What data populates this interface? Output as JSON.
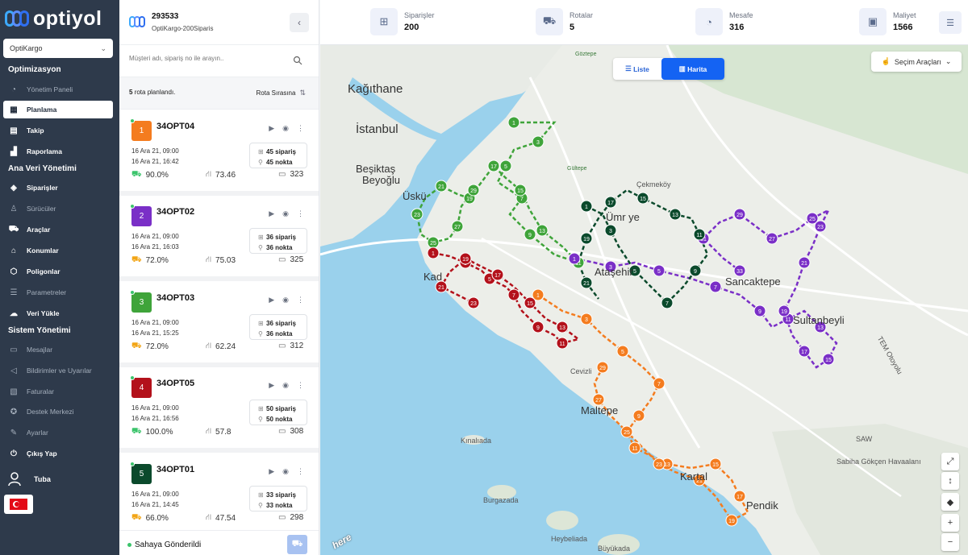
{
  "app": {
    "brand": "optiyol"
  },
  "org_select": {
    "value": "OptiKargo"
  },
  "nav": {
    "sections": [
      "Optimizasyon",
      "Ana Veri Yönetimi",
      "Sistem Yönetimi"
    ],
    "items": [
      {
        "label": "Yönetim Paneli",
        "icon": "dashboard-icon"
      },
      {
        "label": "Planlama",
        "icon": "calendar-icon"
      },
      {
        "label": "Takip",
        "icon": "clipboard-icon"
      },
      {
        "label": "Raporlama",
        "icon": "chart-icon"
      },
      {
        "label": "Siparişler",
        "icon": "box-icon"
      },
      {
        "label": "Sürücüler",
        "icon": "person-icon"
      },
      {
        "label": "Araçlar",
        "icon": "truck-icon"
      },
      {
        "label": "Konumlar",
        "icon": "location-icon"
      },
      {
        "label": "Poligonlar",
        "icon": "polygon-icon"
      },
      {
        "label": "Parametreler",
        "icon": "sliders-icon"
      },
      {
        "label": "Veri Yükle",
        "icon": "cloud-upload-icon"
      },
      {
        "label": "Mesajlar",
        "icon": "chat-icon"
      },
      {
        "label": "Bildirimler ve Uyarılar",
        "icon": "megaphone-icon"
      },
      {
        "label": "Faturalar",
        "icon": "invoice-icon"
      },
      {
        "label": "Destek Merkezi",
        "icon": "lightbulb-icon"
      },
      {
        "label": "Ayarlar",
        "icon": "wrench-icon"
      },
      {
        "label": "Çıkış Yap",
        "icon": "logout-icon"
      }
    ],
    "user": "Tuba"
  },
  "panel": {
    "id": "293533",
    "subtitle": "OptiKargo-200Siparis",
    "search_placeholder": "Müşteri adı, sipariş no ile arayın..",
    "summary_count": "5",
    "summary_text": "rota planlandı.",
    "sort_label": "Rota Sırasına",
    "footer_label": "Sahaya Gönderildi"
  },
  "routes": [
    {
      "num": "1",
      "name": "34OPT04",
      "color": "#f47c1f",
      "start": "16 Ara 21, 09:00",
      "end": "16 Ara 21, 16:42",
      "orders": "45 sipariş",
      "stops": "45 nokta",
      "fill": "90.0%",
      "distance": "73.46",
      "cost": "323"
    },
    {
      "num": "2",
      "name": "34OPT02",
      "color": "#7a2fc7",
      "start": "16 Ara 21, 09:00",
      "end": "16 Ara 21, 16:03",
      "orders": "36 sipariş",
      "stops": "36 nokta",
      "fill": "72.0%",
      "distance": "75.03",
      "cost": "325"
    },
    {
      "num": "3",
      "name": "34OPT03",
      "color": "#3fa43a",
      "start": "16 Ara 21, 09:00",
      "end": "16 Ara 21, 15:25",
      "orders": "36 sipariş",
      "stops": "36 nokta",
      "fill": "72.0%",
      "distance": "62.24",
      "cost": "312"
    },
    {
      "num": "4",
      "name": "34OPT05",
      "color": "#b3111b",
      "start": "16 Ara 21, 09:00",
      "end": "16 Ara 21, 16:56",
      "orders": "50 sipariş",
      "stops": "50 nokta",
      "fill": "100.0%",
      "distance": "57.8",
      "cost": "308"
    },
    {
      "num": "5",
      "name": "34OPT01",
      "color": "#0b4a2c",
      "start": "16 Ara 21, 09:00",
      "end": "16 Ara 21, 14:45",
      "orders": "33 sipariş",
      "stops": "33 nokta",
      "fill": "66.0%",
      "distance": "47.54",
      "cost": "298"
    }
  ],
  "topbar": {
    "stats": [
      {
        "label": "Siparişler",
        "value": "200",
        "icon": "boxes-icon"
      },
      {
        "label": "Rotalar",
        "value": "5",
        "icon": "truck-icon"
      },
      {
        "label": "Mesafe",
        "value": "316",
        "icon": "gauge-icon"
      },
      {
        "label": "Maliyet",
        "value": "1566",
        "icon": "wallet-icon"
      }
    ]
  },
  "map": {
    "view_list": "Liste",
    "view_map": "Harita",
    "tools_label": "Seçim Araçları",
    "labels": {
      "kagithane": "Kağıthane",
      "istanbul": "İstanbul",
      "besiktas": "Beşiktaş",
      "beyoglu": "Beyoğlu",
      "uskudar": "Üskü",
      "kadikoy": "Kad",
      "umraniye": "Ümr  ye",
      "cekmekoy": "Çekmeköy",
      "atasehir": "Ataşehir",
      "sancaktepe": "Sancaktepe",
      "sultanbeyli": "Sultanbeyli",
      "maltepe": "Maltepe",
      "kartal": "Kartal",
      "pendik": "Pendik",
      "kinaliada": "Kınalıada",
      "burgazada": "Burgazada",
      "heybeliada": "Heybeliada",
      "buyukada": "Büyükada",
      "saw": "SAW",
      "sabiha": "Sabiha Gökçen Havaalanı",
      "cevizli": "Cevizli",
      "gultepe": "Gültepe",
      "goztepe": "Göztepe",
      "tem": "TEM Otoyolu"
    },
    "attribution": "here"
  }
}
